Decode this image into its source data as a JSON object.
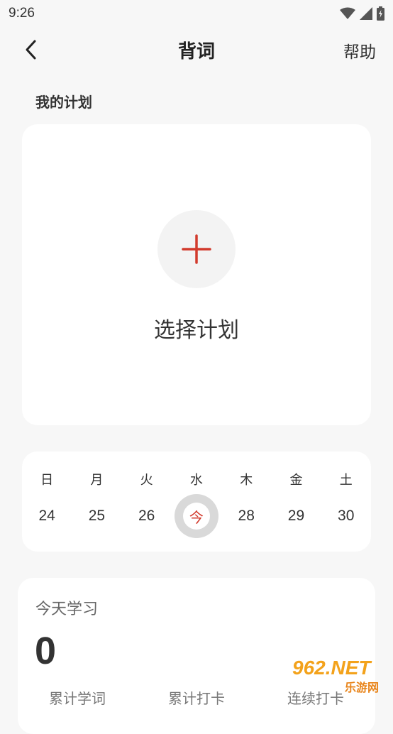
{
  "status_bar": {
    "time": "9:26"
  },
  "app_bar": {
    "title": "背词",
    "help": "帮助"
  },
  "section": {
    "my_plan": "我的计划"
  },
  "plan_card": {
    "choose_label": "选择计划"
  },
  "calendar": {
    "weekdays": [
      "日",
      "月",
      "火",
      "水",
      "木",
      "金",
      "土"
    ],
    "dates": [
      "24",
      "25",
      "26",
      "今",
      "28",
      "29",
      "30"
    ],
    "today_index": 3
  },
  "today_study": {
    "title": "今天学习",
    "count": "0",
    "stats": [
      "累计学词",
      "累计打卡",
      "连续打卡"
    ]
  },
  "colors": {
    "accent": "#d23a2c",
    "background": "#f7f7f7",
    "card": "#ffffff"
  },
  "watermark": {
    "text": "962.NET",
    "subtext": "乐游网"
  }
}
